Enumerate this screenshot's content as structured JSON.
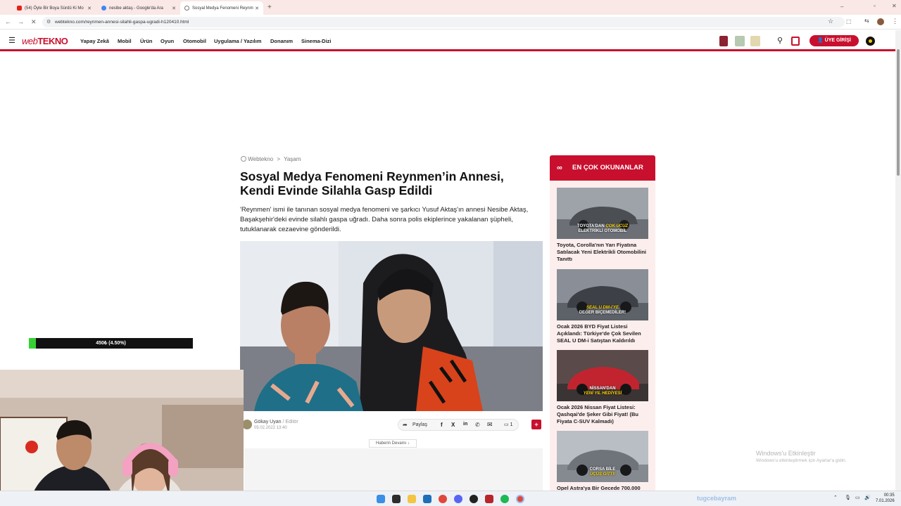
{
  "browser": {
    "tabs": [
      {
        "label": "(54) Öyle Bir Boya Sürdü Ki Mo"
      },
      {
        "label": "nesibe aktaş - Google'da Ara"
      },
      {
        "label": "Sosyal Medya Fenomeni Reynm"
      }
    ],
    "url": "webtekno.com/reynmen-annesi-silahli-gaspa-ugradi-h120410.html"
  },
  "site": {
    "logo_web": "web",
    "logo_tekno": "TEKNO",
    "nav": [
      "Yapay Zekâ",
      "Mobil",
      "Ürün",
      "Oyun",
      "Otomobil",
      "Uygulama / Yazılım",
      "Donanım",
      "Sinema-Dizi"
    ],
    "login": "ÜYE GİRİŞİ"
  },
  "article": {
    "breadcrumb_site": "Webtekno",
    "breadcrumb_sep": ">",
    "breadcrumb_cat": "Yaşam",
    "headline": "Sosyal Medya Fenomeni Reynmen’in Annesi, Kendi Evinde Silahla Gasp Edildi",
    "lead": "'Reynmen' ismi ile tanınan sosyal medya fenomeni ve şarkıcı Yusuf Aktaş'ın annesi Nesibe Aktaş, Başakşehir'deki evinde silahlı gaspa uğradı. Daha sonra polis ekiplerince yakalanan şüpheli, tutuklanarak cezaevine gönderildi.",
    "author": "Gökay Uyan",
    "author_role": "/ Editör",
    "date": "05.02.2022 13:40",
    "share": "Paylaş",
    "comments": "1",
    "read_more": "Haberin Devamı ↓"
  },
  "sidebar": {
    "title": "EN ÇOK OKUNANLAR",
    "items": [
      {
        "cap1": "TOYOTA'DAN",
        "cap_hl": "ÇOK UCUZ",
        "cap2": "ELEKTRİKLİ OTOMOBİL",
        "title": "Toyota, Corolla'nın Yarı Fiyatına Satılacak Yeni Elektrikli Otomobilini Tanıttı"
      },
      {
        "cap1": "",
        "cap_hl": "SEAL U DM-i'YE",
        "cap2": "DEĞER BİÇEMEDİLER!",
        "title": "Ocak 2026 BYD Fiyat Listesi Açıklandı: Türkiye'de Çok Sevilen SEAL U DM-i Satıştan Kaldırıldı"
      },
      {
        "cap1": "NİSSAN'DAN",
        "cap_hl": "YENİ YIL HEDİYESİ",
        "cap2": "",
        "title": "Ocak 2026 Nissan Fiyat Listesi: Qashqai'de Şeker Gibi Fiyat! (Bu Fiyata C-SUV Kalmadı)"
      },
      {
        "cap1": "CORSA BİLE",
        "cap_hl": "UÇUŞ GİTTİ!",
        "cap2": "",
        "title": "Opel Astra'ya Bir Gecede 700.000"
      }
    ]
  },
  "overlay": {
    "progress_text": "450₺ (4.50%)",
    "progress_fraction": 0.045
  },
  "taskbar": {
    "streamer": "tugcebayram",
    "time": "00:35",
    "date": "7.01.2026"
  },
  "windows": {
    "activate_title": "Windows'u Etkinleştir",
    "activate_sub": "Windows'u etkinleştirmek için Ayarlar'a gidin."
  },
  "colors": {
    "brand_red": "#c8102e",
    "progress_green": "#35d135"
  }
}
